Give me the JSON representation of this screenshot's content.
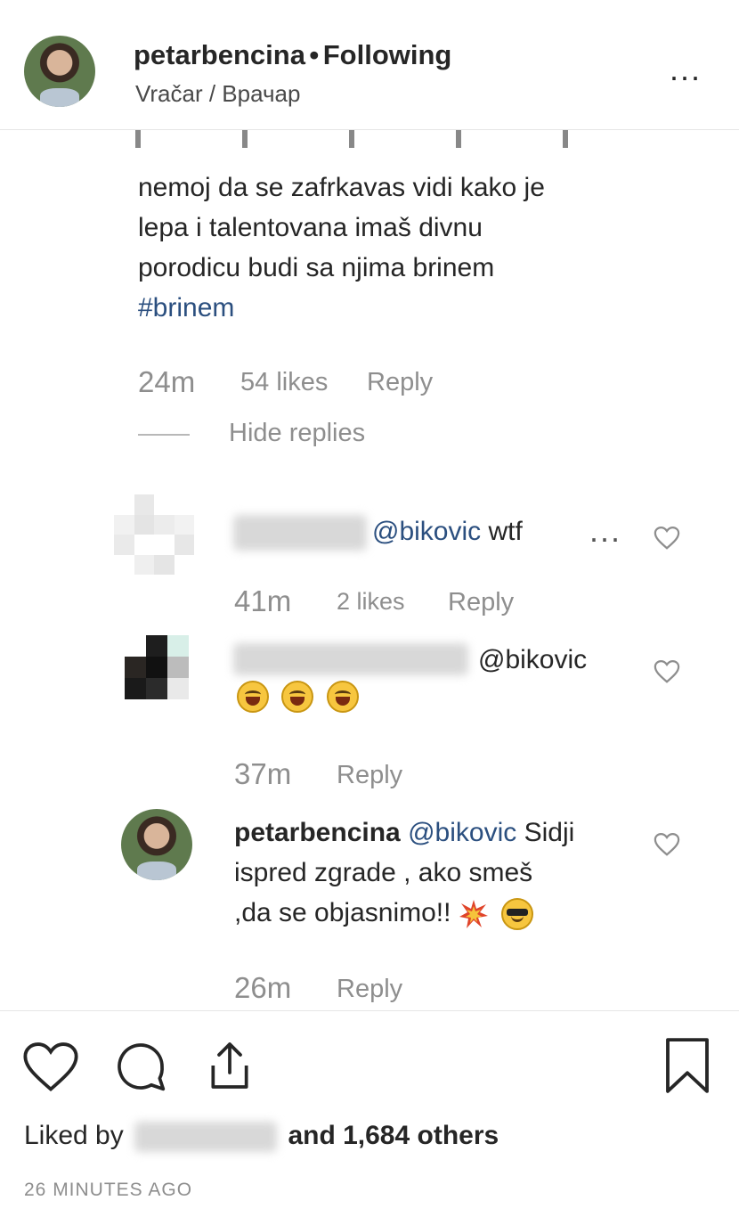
{
  "header": {
    "username": "petarbencina",
    "separator": "•",
    "follow_status": "Following",
    "location": "Vračar / Врачар",
    "more": "..."
  },
  "main_comment": {
    "lines": [
      "nemoj da se zafrkavas vidi kako je",
      "lepa i talentovana imaš divnu",
      "porodicu budi sa njima brinem"
    ],
    "hashtag": "#brinem",
    "time": "24m",
    "likes": "54 likes",
    "reply": "Reply",
    "hide_replies": "Hide replies"
  },
  "replies": [
    {
      "mention": "@bikovic",
      "text": "wtf",
      "time": "41m",
      "likes": "2 likes",
      "reply": "Reply",
      "more": "..."
    },
    {
      "mention": "@bikovic",
      "emoji": [
        "joy-emoji",
        "joy-emoji",
        "joy-emoji"
      ],
      "time": "37m",
      "reply": "Reply"
    },
    {
      "username": "petarbencina",
      "mention": "@bikovic",
      "line1": "Sidji",
      "line2": "ispred zgrade , ako smeš",
      "line3": ",da se objasnimo!!",
      "emoji": [
        "collision-emoji",
        "sunglasses-emoji"
      ],
      "time": "26m",
      "reply": "Reply"
    }
  ],
  "footer": {
    "liked_prefix": "Liked by",
    "liked_suffix": "and 1,684 others",
    "time_ago": "26 MINUTES AGO"
  }
}
